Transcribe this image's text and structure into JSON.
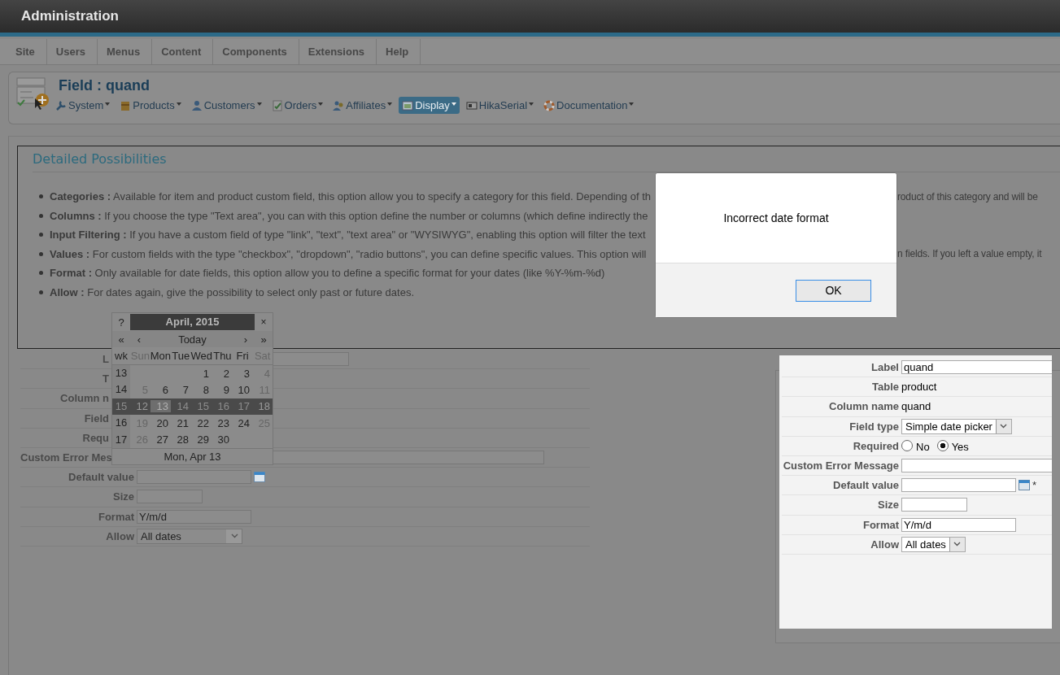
{
  "header": {
    "title": "Administration"
  },
  "menu": [
    {
      "label": "Site"
    },
    {
      "label": "Users"
    },
    {
      "label": "Menus"
    },
    {
      "label": "Content"
    },
    {
      "label": "Components"
    },
    {
      "label": "Extensions"
    },
    {
      "label": "Help"
    }
  ],
  "toolbar": {
    "title": "Field : quand",
    "items": [
      {
        "label": "System",
        "selected": false
      },
      {
        "label": "Products",
        "selected": false
      },
      {
        "label": "Customers",
        "selected": false
      },
      {
        "label": "Orders",
        "selected": false
      },
      {
        "label": "Affiliates",
        "selected": false
      },
      {
        "label": "Display",
        "selected": true
      },
      {
        "label": "HikaSerial",
        "selected": false
      },
      {
        "label": "Documentation",
        "selected": false
      }
    ]
  },
  "info": {
    "title": "Detailed Possibilities",
    "bullets": [
      {
        "text": "**Categories :** Available for item and product custom field, this option allow you to specify a category for this field. Depending of th",
        "text_right": "roduct of this category and will be"
      },
      {
        "text": "**Columns :** If you choose the type \"Text area\", you can with this option define the number or columns (which define indirectly the"
      },
      {
        "text": "**Input Filtering :** If you have a custom field of type \"link\", \"text\", \"text area\" or \"WYSIWYG\", enabling this option will filter the text"
      },
      {
        "text": "**Values :** For custom fields with the type \"checkbox\", \"dropdown\", \"radio buttons\", you can define specific values. This option will",
        "text_right": "n fields. If you left a value empty, it"
      },
      {
        "text": "**Format :** Only available for date fields, this option allow you to define a specific format for your dates (like %Y-%m-%d)"
      },
      {
        "text": "**Allow :** For dates again, give the possibility to select only past or future dates."
      }
    ]
  },
  "form": {
    "rows_under_calendar": [
      {
        "label": "L",
        "kind": "long_input"
      },
      {
        "label": "T"
      },
      {
        "label": "Column n"
      },
      {
        "label": "Field"
      },
      {
        "label": "Requ"
      },
      {
        "label": "Custom Error Mes",
        "kind": "wide_input"
      }
    ],
    "rows": [
      {
        "label": "Default value",
        "kind": "date"
      },
      {
        "label": "Size",
        "kind": "short_input"
      },
      {
        "label": "Format",
        "kind": "input",
        "value": "Y/m/d"
      },
      {
        "label": "Allow",
        "kind": "select",
        "value": "All dates"
      }
    ]
  },
  "calendar": {
    "title": "April, 2015",
    "help": "?",
    "close": "×",
    "nav": {
      "prev_year": "«",
      "prev_month": "‹",
      "today": "Today",
      "next_month": "›",
      "next_year": "»"
    },
    "week_header": "wk",
    "day_names": [
      {
        "label": "Sun",
        "weekend": true
      },
      {
        "label": "Mon",
        "weekend": false
      },
      {
        "label": "Tue",
        "weekend": false
      },
      {
        "label": "Wed",
        "weekend": false
      },
      {
        "label": "Thu",
        "weekend": false
      },
      {
        "label": "Fri",
        "weekend": false
      },
      {
        "label": "Sat",
        "weekend": true
      }
    ],
    "weeks": [
      {
        "wk": "13",
        "selected": false,
        "days": [
          {
            "kind": "blank"
          },
          {
            "kind": "blank"
          },
          {
            "kind": "blank"
          },
          {
            "kind": "day",
            "day": "1",
            "weekend": false,
            "selected": false
          },
          {
            "kind": "day",
            "day": "2",
            "weekend": false,
            "selected": false
          },
          {
            "kind": "day",
            "day": "3",
            "weekend": false,
            "selected": false
          },
          {
            "kind": "day",
            "day": "4",
            "weekend": true,
            "selected": false
          }
        ]
      },
      {
        "wk": "14",
        "selected": false,
        "days": [
          {
            "kind": "day",
            "day": "5",
            "weekend": true,
            "selected": false
          },
          {
            "kind": "day",
            "day": "6",
            "weekend": false,
            "selected": false
          },
          {
            "kind": "day",
            "day": "7",
            "weekend": false,
            "selected": false
          },
          {
            "kind": "day",
            "day": "8",
            "weekend": false,
            "selected": false
          },
          {
            "kind": "day",
            "day": "9",
            "weekend": false,
            "selected": false
          },
          {
            "kind": "day",
            "day": "10",
            "weekend": false,
            "selected": false
          },
          {
            "kind": "day",
            "day": "11",
            "weekend": true,
            "selected": false
          }
        ]
      },
      {
        "wk": "15",
        "selected": true,
        "days": [
          {
            "kind": "day",
            "day": "12",
            "weekend": true,
            "selected": false
          },
          {
            "kind": "day",
            "day": "13",
            "weekend": false,
            "selected": true
          },
          {
            "kind": "day",
            "day": "14",
            "weekend": false,
            "selected": false
          },
          {
            "kind": "day",
            "day": "15",
            "weekend": false,
            "selected": false
          },
          {
            "kind": "day",
            "day": "16",
            "weekend": false,
            "selected": false
          },
          {
            "kind": "day",
            "day": "17",
            "weekend": false,
            "selected": false
          },
          {
            "kind": "day",
            "day": "18",
            "weekend": true,
            "selected": false
          }
        ]
      },
      {
        "wk": "16",
        "selected": false,
        "days": [
          {
            "kind": "day",
            "day": "19",
            "weekend": true,
            "selected": false
          },
          {
            "kind": "day",
            "day": "20",
            "weekend": false,
            "selected": false
          },
          {
            "kind": "day",
            "day": "21",
            "weekend": false,
            "selected": false
          },
          {
            "kind": "day",
            "day": "22",
            "weekend": false,
            "selected": false
          },
          {
            "kind": "day",
            "day": "23",
            "weekend": false,
            "selected": false
          },
          {
            "kind": "day",
            "day": "24",
            "weekend": false,
            "selected": false
          },
          {
            "kind": "day",
            "day": "25",
            "weekend": true,
            "selected": false
          }
        ]
      },
      {
        "wk": "17",
        "selected": false,
        "days": [
          {
            "kind": "day",
            "day": "26",
            "weekend": true,
            "selected": false
          },
          {
            "kind": "day",
            "day": "27",
            "weekend": false,
            "selected": false
          },
          {
            "kind": "day",
            "day": "28",
            "weekend": false,
            "selected": false
          },
          {
            "kind": "day",
            "day": "29",
            "weekend": false,
            "selected": false
          },
          {
            "kind": "day",
            "day": "30",
            "weekend": false,
            "selected": false
          },
          {
            "kind": "blank"
          },
          {
            "kind": "blank"
          }
        ]
      }
    ],
    "footer": "Mon, Apr 13"
  },
  "dialog": {
    "message": "Incorrect date format",
    "button": "OK"
  },
  "inset": {
    "rows": [
      {
        "label": "Label",
        "kind": "wide_input",
        "value": "quand"
      },
      {
        "label": "Table",
        "kind": "text",
        "value": "product"
      },
      {
        "label": "Column name",
        "kind": "text",
        "value": "quand"
      },
      {
        "label": "Field type",
        "kind": "select",
        "value": "Simple date picker"
      },
      {
        "label": "Required",
        "kind": "radio",
        "options": [
          {
            "label": "No",
            "selected": false
          },
          {
            "label": "Yes",
            "selected": true
          }
        ]
      },
      {
        "label": "Custom Error Message",
        "kind": "wide_input"
      },
      {
        "label": "Default value",
        "kind": "date",
        "mark": "*"
      },
      {
        "label": "Size",
        "kind": "short_input"
      },
      {
        "label": "Format",
        "kind": "input",
        "value": "Y/m/d"
      },
      {
        "label": "Allow",
        "kind": "select",
        "value": "All dates"
      }
    ]
  }
}
